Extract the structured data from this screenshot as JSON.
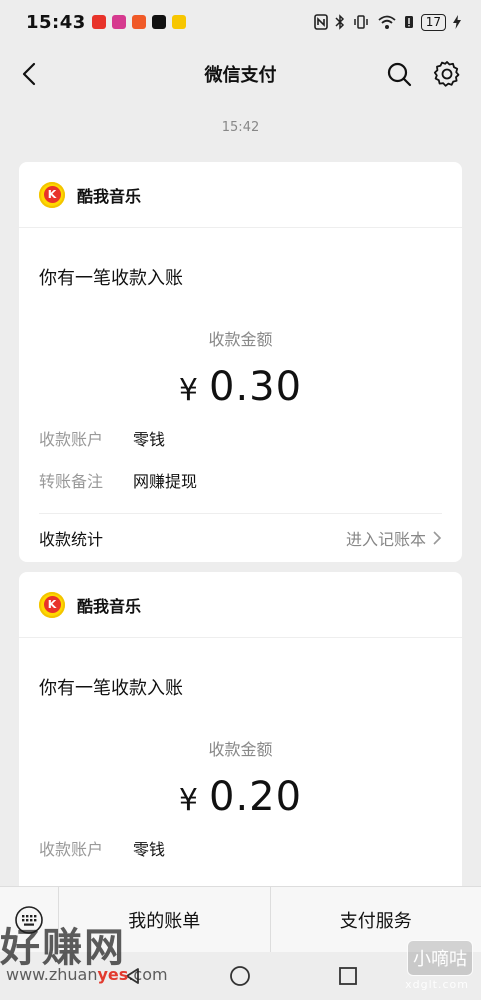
{
  "status_bar": {
    "time": "15:43",
    "battery": "17",
    "app_icon_colors": [
      "#e8332a",
      "#d63a8f",
      "#f05a28",
      "#111111",
      "#f7c600"
    ]
  },
  "nav": {
    "title": "微信支付",
    "back_icon": "chevron-left-icon",
    "search_icon": "search-icon",
    "settings_icon": "gear-icon"
  },
  "timestamp": "15:42",
  "messages": [
    {
      "app_name": "酷我音乐",
      "logo_letter": "K",
      "title": "你有一笔收款入账",
      "amount_label": "收款金额",
      "currency": "¥",
      "amount": "0.30",
      "rows": [
        {
          "key": "收款账户",
          "value": "零钱"
        },
        {
          "key": "转账备注",
          "value": "网赚提现"
        }
      ],
      "footer_left": "收款统计",
      "footer_right": "进入记账本"
    },
    {
      "app_name": "酷我音乐",
      "logo_letter": "K",
      "title": "你有一笔收款入账",
      "amount_label": "收款金额",
      "currency": "¥",
      "amount": "0.20",
      "rows": [
        {
          "key": "收款账户",
          "value": "零钱"
        }
      ]
    }
  ],
  "bottom_menu": {
    "keyboard_icon": "keyboard-icon",
    "item1": "我的账单",
    "item2": "支付服务"
  },
  "watermark": {
    "main": "好赚网",
    "sub_prefix": "www.zhuan",
    "sub_highlight": "yes",
    "sub_suffix": ".com",
    "right": "小嘀咕",
    "right_sub": "xdglt.com"
  },
  "colors": {
    "accent": "#07c160",
    "background": "#ededed",
    "card": "#ffffff",
    "logo_yellow": "#ffd800",
    "logo_red": "#e8332a"
  }
}
